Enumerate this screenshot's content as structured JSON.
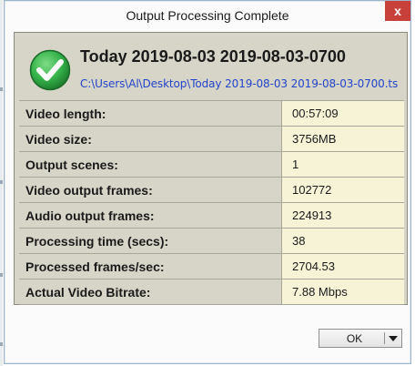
{
  "window": {
    "title": "Output Processing Complete",
    "close_glyph": "x"
  },
  "header": {
    "icon": "check-icon",
    "title": "Today 2019-08-03 2019-08-03-0700",
    "path": "C:\\Users\\Al\\Desktop\\Today 2019-08-03 2019-08-03-0700.ts"
  },
  "stats": {
    "rows": [
      {
        "label": "Video length:",
        "value": "00:57:09"
      },
      {
        "label": "Video size:",
        "value": "3756MB"
      },
      {
        "label": "Output scenes:",
        "value": "1"
      },
      {
        "label": "Video output frames:",
        "value": "102772"
      },
      {
        "label": "Audio output frames:",
        "value": "224913"
      },
      {
        "label": "Processing time (secs):",
        "value": "38"
      },
      {
        "label": "Processed frames/sec:",
        "value": "2704.53"
      },
      {
        "label": "Actual Video Bitrate:",
        "value": "7.88 Mbps"
      }
    ]
  },
  "buttons": {
    "ok_label": "OK",
    "dropdown_icon": "caret-down-icon"
  },
  "colors": {
    "panel_bg": "#d7d5c7",
    "value_bg": "#f6f3d7",
    "path_link": "#2244cc",
    "close_red": "#c7403a",
    "check_green": "#35b34a"
  }
}
